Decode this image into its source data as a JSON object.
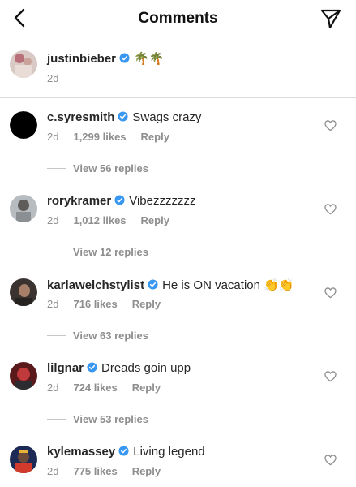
{
  "header": {
    "title": "Comments"
  },
  "caption": {
    "username": "justinbieber",
    "text": "🌴🌴",
    "time": "2d"
  },
  "comments": [
    {
      "username": "c.syresmith",
      "text": "Swags crazy",
      "time": "2d",
      "likes": "1,299 likes",
      "reply": "Reply",
      "view_replies": "View 56 replies"
    },
    {
      "username": "rorykramer",
      "text": "Vibezzzzzzz",
      "time": "2d",
      "likes": "1,012 likes",
      "reply": "Reply",
      "view_replies": "View 12 replies"
    },
    {
      "username": "karlawelchstylist",
      "text": "He is ON vacation 👏👏",
      "time": "2d",
      "likes": "716 likes",
      "reply": "Reply",
      "view_replies": "View 63 replies"
    },
    {
      "username": "lilgnar",
      "text": "Dreads goin upp",
      "time": "2d",
      "likes": "724 likes",
      "reply": "Reply",
      "view_replies": "View 53 replies"
    },
    {
      "username": "kylemassey",
      "text": "Living legend",
      "time": "2d",
      "likes": "775 likes",
      "reply": "Reply"
    }
  ],
  "colors": {
    "verified": "#3897f0",
    "secondary_text": "#8e8e8e",
    "divider": "#dbdbdb"
  }
}
